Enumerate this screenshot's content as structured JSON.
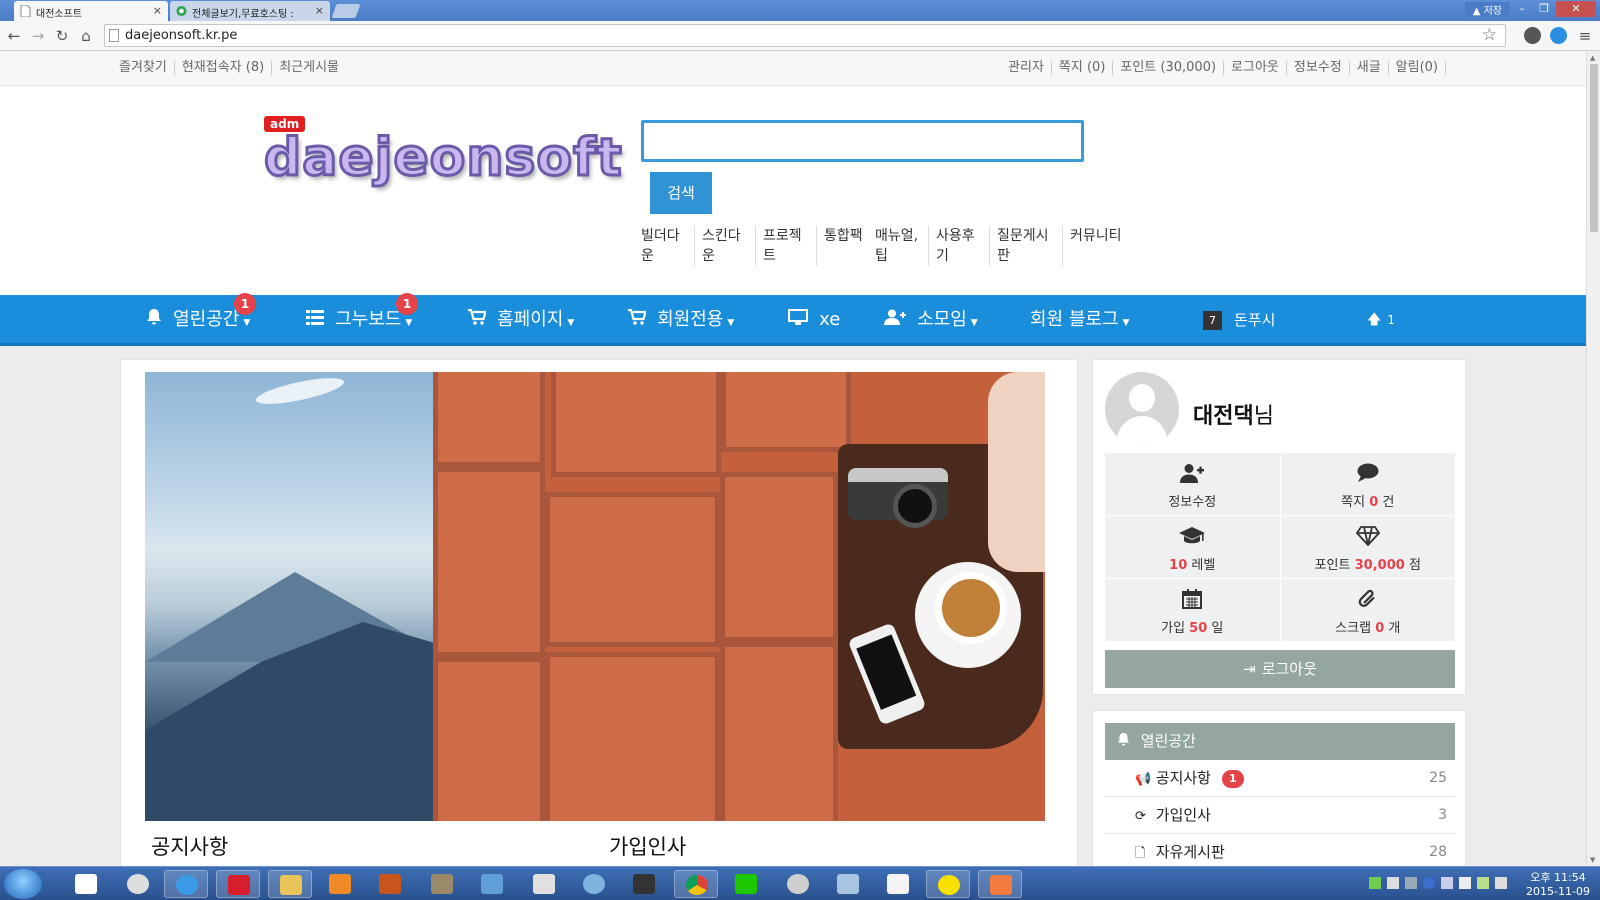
{
  "browser": {
    "tabs": [
      {
        "title": "대전소프트",
        "active": true
      },
      {
        "title": "전체글보기,무료호스팅 :",
        "active": false
      }
    ],
    "warning_label": "저장",
    "url": "daejeonsoft.kr.pe"
  },
  "topbar": {
    "left_links": [
      "즐겨찾기",
      "현재접속자 (8)",
      "최근게시물"
    ],
    "right_links": [
      "관리자",
      "쪽지 (0)",
      "포인트 (30,000)",
      "로그아웃",
      "정보수정",
      "새글",
      "알림(0)"
    ]
  },
  "header": {
    "admin_badge": "adm",
    "logo_text": "daejeonsoft",
    "search_placeholder": "",
    "search_button": "검색",
    "submenu": [
      "빌더다운",
      "스킨다운",
      "프로젝트",
      "통합팩",
      "매뉴얼,팁",
      "사용후기",
      "질문게시판",
      "커뮤니티"
    ]
  },
  "mainnav": {
    "items": [
      {
        "label": "열린공간",
        "icon": "bell-icon",
        "badge": "1"
      },
      {
        "label": "그누보드",
        "icon": "list-icon",
        "badge": "1"
      },
      {
        "label": "홈페이지",
        "icon": "cart-icon",
        "badge": ""
      },
      {
        "label": "회원전용",
        "icon": "cart-icon",
        "badge": ""
      },
      {
        "label": "xe",
        "icon": "monitor-icon",
        "badge": ""
      },
      {
        "label": "소모임",
        "icon": "user-plus-icon",
        "badge": ""
      },
      {
        "label": "회원 블로그",
        "icon": "",
        "badge": ""
      }
    ],
    "calendar_day": "7",
    "extra_label": "돈푸시",
    "up_count": "1"
  },
  "content": {
    "section_titles": [
      "공지사항",
      "가입인사"
    ]
  },
  "profile": {
    "name": "대전댁",
    "suffix": "님",
    "stats": [
      {
        "icon": "user-plus-icon",
        "prefix": "정보수정",
        "value": "",
        "suffix": ""
      },
      {
        "icon": "comment-icon",
        "prefix": "쪽지",
        "value": "0",
        "suffix": "건"
      },
      {
        "icon": "graduation-cap-icon",
        "prefix": "",
        "value": "10",
        "suffix": "레벨"
      },
      {
        "icon": "diamond-icon",
        "prefix": "포인트",
        "value": "30,000",
        "suffix": "점"
      },
      {
        "icon": "calendar-icon",
        "prefix": "가입",
        "value": "50",
        "suffix": "일"
      },
      {
        "icon": "paperclip-icon",
        "prefix": "스크랩",
        "value": "0",
        "suffix": "개"
      }
    ],
    "logout_label": "로그아웃"
  },
  "board": {
    "title": "열린공간",
    "rows": [
      {
        "icon": "megaphone-icon",
        "label": "공지사항",
        "badge": "1",
        "count": "25"
      },
      {
        "icon": "refresh-icon",
        "label": "가입인사",
        "badge": "",
        "count": "3"
      },
      {
        "icon": "file-icon",
        "label": "자유게시판",
        "badge": "",
        "count": "28"
      }
    ]
  },
  "taskbar": {
    "clock_time": "오후 11:54",
    "clock_date": "2015-11-09"
  },
  "colors": {
    "nav_blue": "#1a8edb",
    "badge_red": "#e5424a",
    "panel_gray": "#95a5a0"
  }
}
